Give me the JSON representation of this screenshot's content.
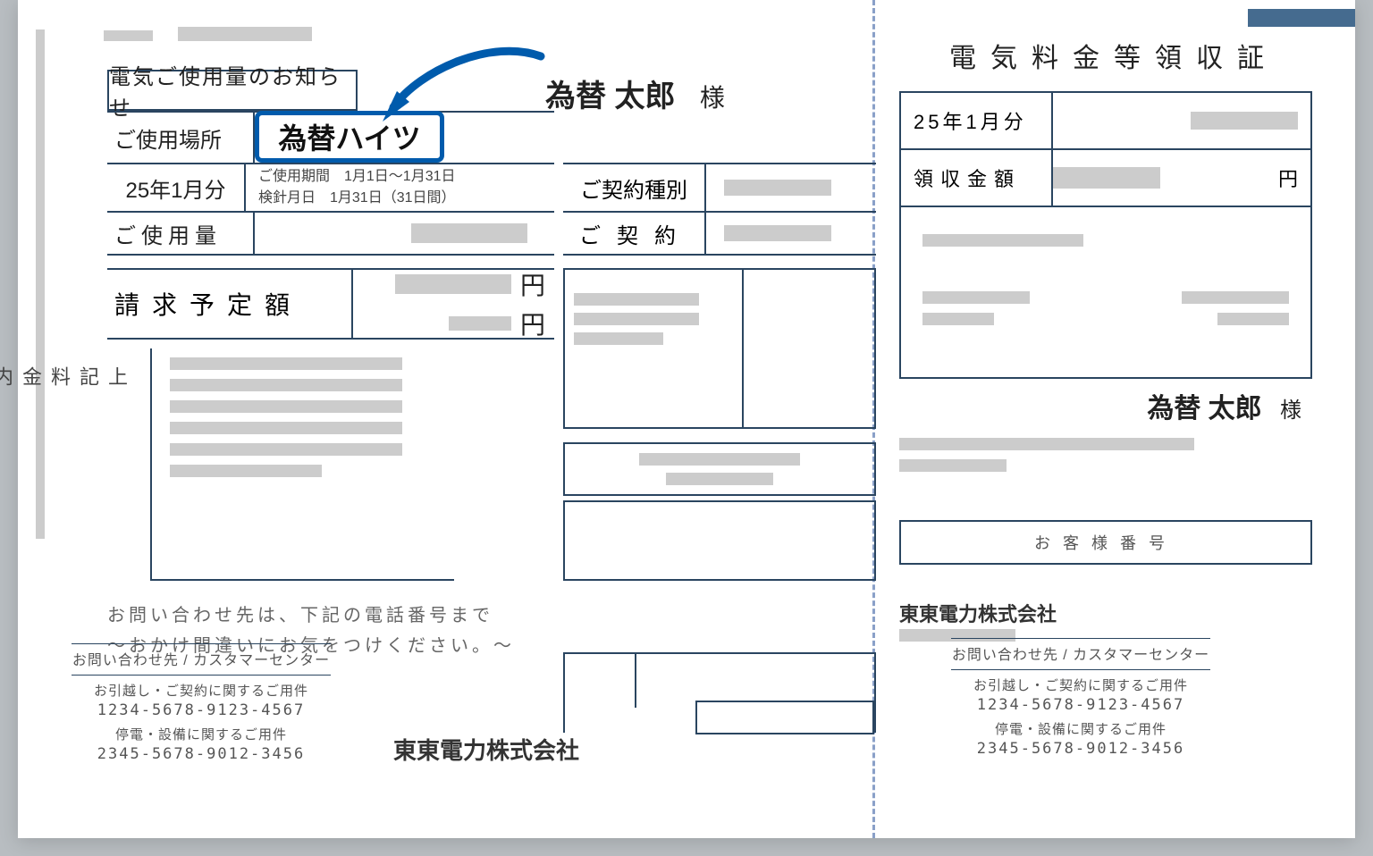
{
  "left": {
    "notice_title": "電気ご使用量のお知らせ",
    "customer_name": "為替 太郎",
    "honorific": "様",
    "location_label": "ご使用場所",
    "location_value": "為替ハイツ",
    "period_value": "25年1月分",
    "period_line1": "ご使用期間　1月1日〜1月31日",
    "period_line2": "検針月日　1月31日（31日間）",
    "usage_label": "ご使用量",
    "billing_label": "請求予定額",
    "yen": "円",
    "contract_type_label": "ご契約種別",
    "contract_label": "ご契約",
    "breakdown_label": "上記料金内訳",
    "inquiry_line1": "お問い合わせ先は、下記の電話番号まで",
    "inquiry_line2": "〜おかけ間違いにお気をつけください。〜",
    "company": "東東電力株式会社"
  },
  "contact": {
    "title": "お問い合わせ先 / カスタマーセンター",
    "move_label": "お引越し・ご契約に関するご用件",
    "move_tel": "1234-5678-9123-4567",
    "outage_label": "停電・設備に関するご用件",
    "outage_tel": "2345-5678-9012-3456"
  },
  "right": {
    "receipt_title": "電気料金等領収証",
    "period_value": "25年1月分",
    "amount_label": "領収金額",
    "yen": "円",
    "customer_name": "為替 太郎",
    "honorific": "様",
    "customer_no_label": "お客様番号",
    "company": "東東電力株式会社"
  }
}
